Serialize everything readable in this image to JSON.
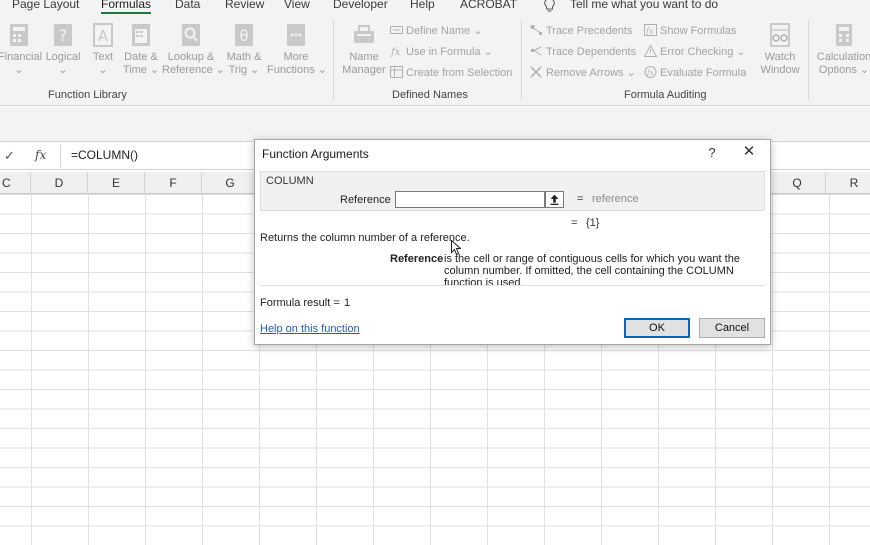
{
  "tabs": [
    "Page Layout",
    "Formulas",
    "Data",
    "Review",
    "View",
    "Developer",
    "Help",
    "ACROBAT"
  ],
  "active_tab": "Formulas",
  "tell_me": "Tell me what you want to do",
  "ribbon": {
    "function_library": {
      "label": "Function Library",
      "buttons": {
        "financial": {
          "line1": "Financial",
          "line2": "⌄"
        },
        "logical": {
          "line1": "Logical",
          "line2": "⌄"
        },
        "text": {
          "line1": "Text",
          "line2": "⌄"
        },
        "datetime": {
          "line1": "Date &",
          "line2": "Time ⌄"
        },
        "lookup": {
          "line1": "Lookup &",
          "line2": "Reference ⌄"
        },
        "math": {
          "line1": "Math &",
          "line2": "Trig ⌄"
        },
        "more": {
          "line1": "More",
          "line2": "Functions ⌄"
        }
      }
    },
    "defined_names": {
      "label": "Defined Names",
      "name_manager": {
        "line1": "Name",
        "line2": "Manager"
      },
      "define_name": "Define Name ⌄",
      "use_in_formula": "Use in Formula ⌄",
      "create_from_selection": "Create from Selection"
    },
    "formula_auditing": {
      "label": "Formula Auditing",
      "trace_precedents": "Trace Precedents",
      "trace_dependents": "Trace Dependents",
      "remove_arrows": "Remove Arrows  ⌄",
      "show_formulas": "Show Formulas",
      "error_checking": "Error Checking  ⌄",
      "evaluate_formula": "Evaluate Formula",
      "watch_window": {
        "line1": "Watch",
        "line2": "Window"
      }
    },
    "calculation": {
      "options": {
        "line1": "Calculation",
        "line2": "Options ⌄"
      }
    }
  },
  "formula_bar": {
    "check": "✓",
    "fx": "fx",
    "formula": "=COLUMN()"
  },
  "columns": [
    "C",
    "D",
    "E",
    "F",
    "G",
    "Q",
    "R"
  ],
  "dialog": {
    "title": "Function Arguments",
    "help": "?",
    "close": "✕",
    "function_name": "COLUMN",
    "arg_label": "Reference",
    "arg_value": "",
    "arg_eq": "=",
    "arg_hint": "reference",
    "result_eq": "=",
    "result_preview": "{1}",
    "description": "Returns the column number of a reference.",
    "param_name": "Reference",
    "param_desc": "is the cell or range of contiguous cells for which you want the column number. If omitted, the cell containing the COLUMN function is used.",
    "formula_result_label": "Formula result =",
    "formula_result_value": "1",
    "help_link": "Help on this function",
    "ok": "OK",
    "cancel": "Cancel"
  }
}
